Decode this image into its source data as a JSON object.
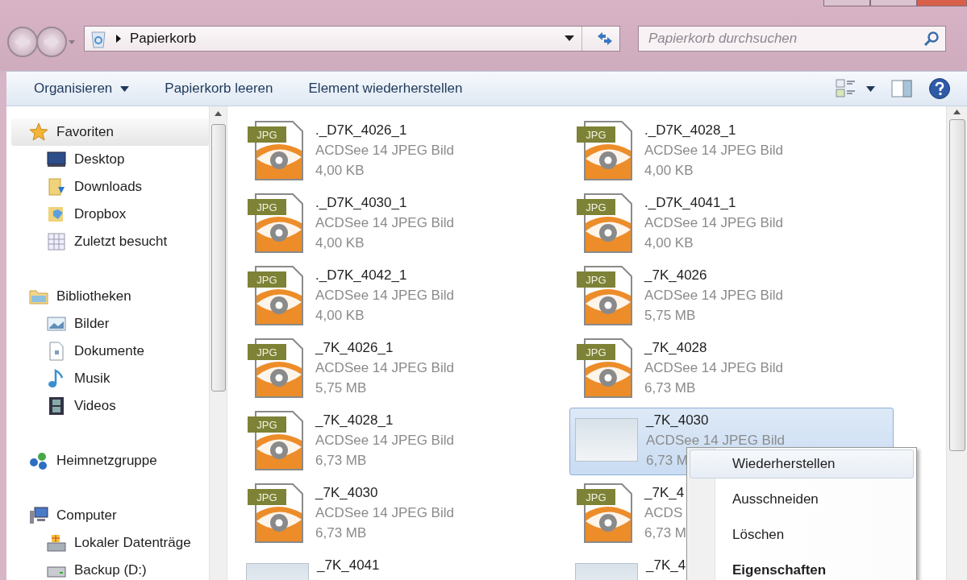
{
  "address_bar": {
    "location": "Papierkorb"
  },
  "search": {
    "placeholder": "Papierkorb durchsuchen"
  },
  "toolbar": {
    "buttons": [
      {
        "label": "Organisieren",
        "kind": "menu"
      },
      {
        "label": "Papierkorb leeren",
        "kind": "plain"
      },
      {
        "label": "Element wiederherstellen",
        "kind": "plain"
      }
    ]
  },
  "sidebar": {
    "groups": [
      {
        "label": "Favoriten",
        "selected": true,
        "children": [
          {
            "label": "Desktop",
            "selected": false
          },
          {
            "label": "Downloads",
            "selected": false
          },
          {
            "label": "Dropbox",
            "selected": false
          },
          {
            "label": "Zuletzt besucht",
            "selected": false
          }
        ]
      },
      {
        "label": "Bibliotheken",
        "selected": false,
        "children": [
          {
            "label": "Bilder",
            "selected": false
          },
          {
            "label": "Dokumente",
            "selected": false
          },
          {
            "label": "Musik",
            "selected": false
          },
          {
            "label": "Videos",
            "selected": false
          }
        ]
      },
      {
        "label": "Heimnetzgruppe",
        "selected": false
      },
      {
        "label": "Computer",
        "selected": false,
        "children": [
          {
            "label": "Lokaler Datenträge",
            "selected": false
          },
          {
            "label": "Backup (D:)",
            "selected": false
          }
        ]
      }
    ]
  },
  "files": [
    {
      "kind": "jpg",
      "badge": "JPG",
      "name": "._D7K_4026_1",
      "type": "ACDSee 14 JPEG Bild",
      "size": "4,00 KB",
      "selected": false
    },
    {
      "kind": "jpg",
      "badge": "JPG",
      "name": "._D7K_4028_1",
      "type": "ACDSee 14 JPEG Bild",
      "size": "4,00 KB",
      "selected": false
    },
    {
      "kind": "jpg",
      "badge": "JPG",
      "name": "._D7K_4030_1",
      "type": "ACDSee 14 JPEG Bild",
      "size": "4,00 KB",
      "selected": false
    },
    {
      "kind": "jpg",
      "badge": "JPG",
      "name": "._D7K_4041_1",
      "type": "ACDSee 14 JPEG Bild",
      "size": "4,00 KB",
      "selected": false
    },
    {
      "kind": "jpg",
      "badge": "JPG",
      "name": "._D7K_4042_1",
      "type": "ACDSee 14 JPEG Bild",
      "size": "4,00 KB",
      "selected": false
    },
    {
      "kind": "jpg",
      "badge": "JPG",
      "name": "_7K_4026",
      "type": "ACDSee 14 JPEG Bild",
      "size": "5,75 MB",
      "selected": false
    },
    {
      "kind": "jpg",
      "badge": "JPG",
      "name": "_7K_4026_1",
      "type": "ACDSee 14 JPEG Bild",
      "size": "5,75 MB",
      "selected": false
    },
    {
      "kind": "jpg",
      "badge": "JPG",
      "name": "_7K_4028",
      "type": "ACDSee 14 JPEG Bild",
      "size": "6,73 MB",
      "selected": false
    },
    {
      "kind": "jpg",
      "badge": "JPG",
      "name": "_7K_4028_1",
      "type": "ACDSee 14 JPEG Bild",
      "size": "6,73 MB",
      "selected": false
    },
    {
      "kind": "photo",
      "name": "_7K_4030",
      "type": "ACDSee 14 JPEG Bild",
      "size": "6,73 M",
      "selected": true
    },
    {
      "kind": "jpg",
      "badge": "JPG",
      "name": "_7K_4030",
      "type": "ACDSee 14 JPEG Bild",
      "size": "6,73 MB",
      "selected": false
    },
    {
      "kind": "jpg",
      "badge": "JPG",
      "name": "_7K_4",
      "type": "ACDS",
      "size": "6,73 M",
      "selected": false
    },
    {
      "kind": "photo",
      "name": "_7K_4041",
      "selected": false
    },
    {
      "kind": "photo",
      "name": "_7K_4",
      "selected": false
    }
  ],
  "context_menu": {
    "items": [
      {
        "label": "Wiederherstellen",
        "selected": true,
        "default": false
      },
      {
        "label": "Ausschneiden",
        "selected": false,
        "default": false
      },
      {
        "label": "Löschen",
        "selected": false,
        "default": false
      },
      {
        "label": "Eigenschaften",
        "selected": false,
        "default": true
      }
    ]
  }
}
